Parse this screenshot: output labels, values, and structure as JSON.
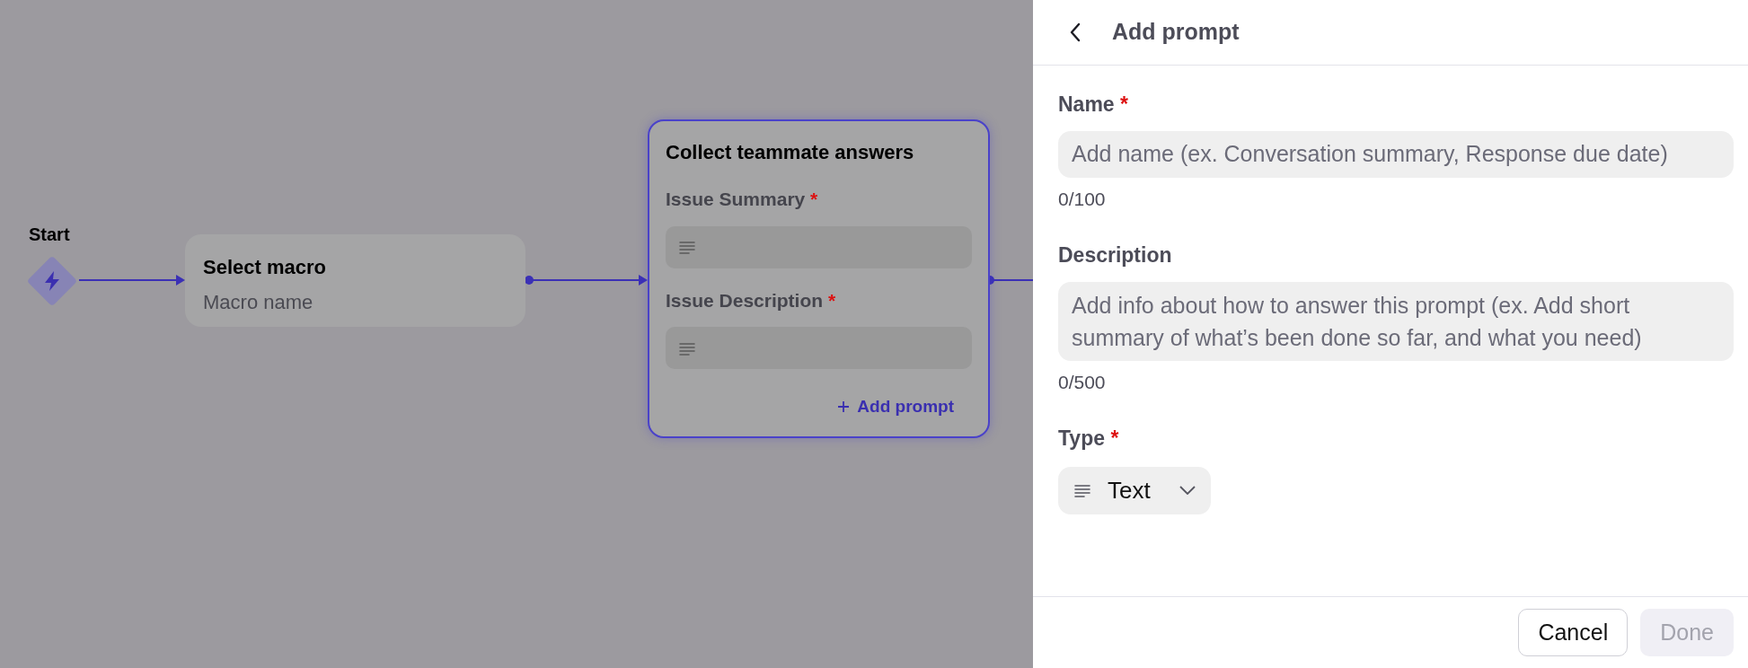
{
  "required_mark": "*",
  "canvas": {
    "start": {
      "label": "Start"
    },
    "nodes": [
      {
        "kind": "simple",
        "title": "Select macro",
        "subtitle": "Macro name",
        "selected": false
      },
      {
        "kind": "form",
        "title": "Collect teammate answers",
        "selected": true,
        "prompts": [
          {
            "label": "Issue Summary",
            "required": true
          },
          {
            "label": "Issue Description",
            "required": true
          }
        ],
        "add_button": "Add prompt"
      }
    ]
  },
  "panel": {
    "title": "Add prompt",
    "fields": [
      {
        "kind": "text",
        "label": "Name",
        "required": true,
        "placeholder": "Add name (ex. Conversation summary, Response due date)",
        "counter": "0/100"
      },
      {
        "kind": "textarea",
        "label": "Description",
        "required": false,
        "placeholder": "Add info about how to answer this prompt (ex. Add short summary of what’s been done so far, and what you need)",
        "counter": "0/500"
      },
      {
        "kind": "select",
        "label": "Type",
        "required": true,
        "value": "Text"
      }
    ],
    "buttons": [
      {
        "label": "Cancel",
        "disabled": false
      },
      {
        "label": "Done",
        "disabled": true
      }
    ]
  }
}
